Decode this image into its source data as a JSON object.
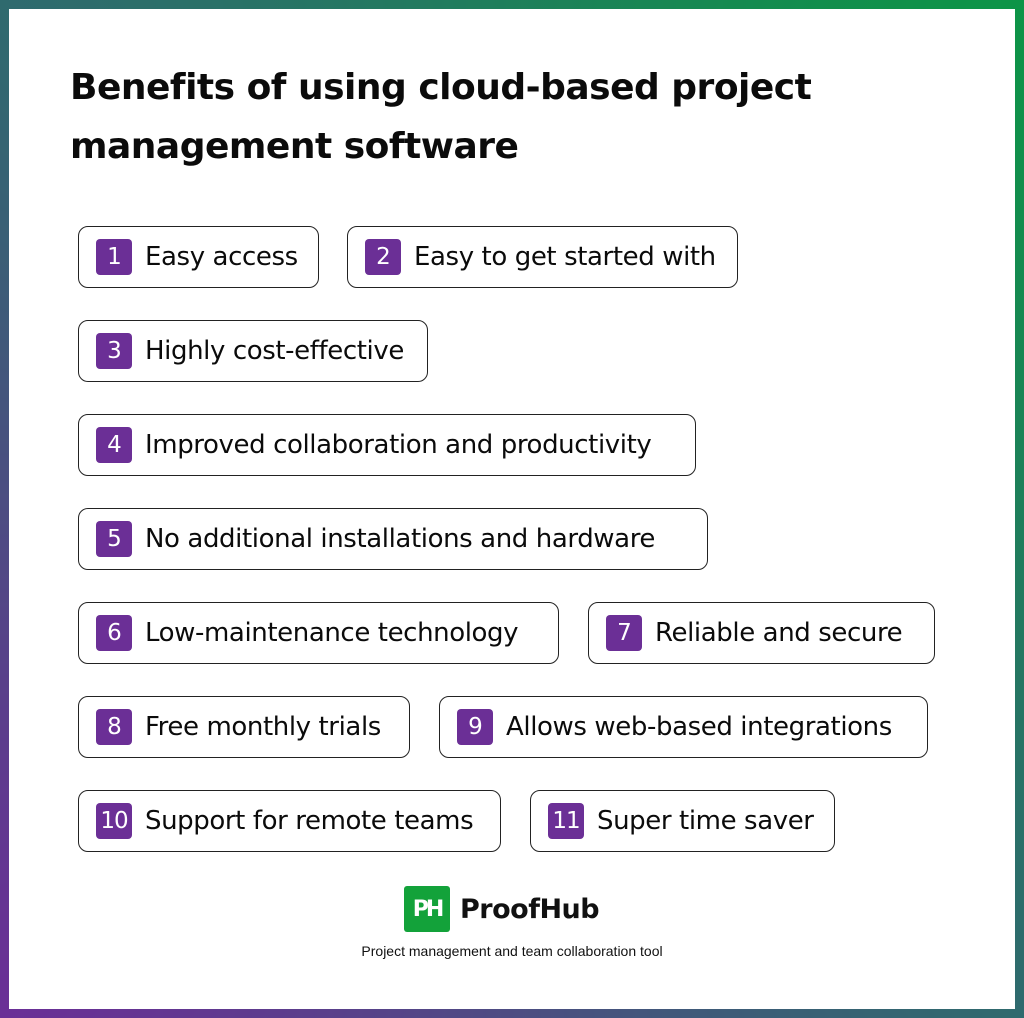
{
  "title": "Benefits of using  cloud-based project management software",
  "benefits": [
    {
      "number": "1",
      "label": "Easy access"
    },
    {
      "number": "2",
      "label": "Easy to get started with"
    },
    {
      "number": "3",
      "label": "Highly cost-effective"
    },
    {
      "number": "4",
      "label": "Improved collaboration and productivity"
    },
    {
      "number": "5",
      "label": "No additional installations and hardware"
    },
    {
      "number": "6",
      "label": "Low-maintenance technology"
    },
    {
      "number": "7",
      "label": "Reliable and secure"
    },
    {
      "number": "8",
      "label": "Free monthly trials"
    },
    {
      "number": "9",
      "label": "Allows web-based integrations"
    },
    {
      "number": "10",
      "label": "Support for remote teams"
    },
    {
      "number": "11",
      "label": "Super time saver"
    }
  ],
  "brand": {
    "logo_text": "PH",
    "name": "ProofHub",
    "tagline": "Project management and team collaboration tool"
  },
  "colors": {
    "accent_purple": "#6b2f96",
    "brand_green": "#13a23a",
    "frame_teal": "#2f6a6e",
    "frame_green": "#0d9447",
    "frame_purple": "#6a2f96"
  }
}
